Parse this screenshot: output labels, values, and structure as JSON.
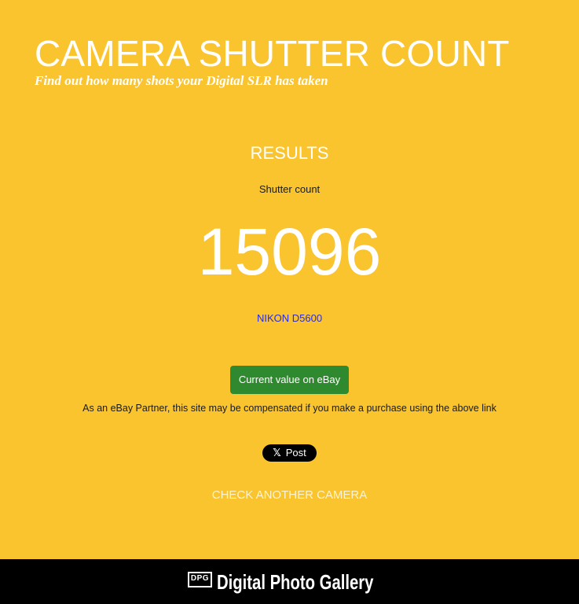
{
  "header": {
    "title": "CAMERA SHUTTER COUNT",
    "tagline": "Find out how many shots your Digital SLR has taken"
  },
  "results": {
    "heading": "RESULTS",
    "count_label": "Shutter count",
    "count_value": "15096",
    "camera_model": "NIKON D5600"
  },
  "ebay": {
    "button_label": "Current value on eBay",
    "disclaimer": "As an eBay Partner, this site may be compensated if you make a purchase using the above link"
  },
  "share": {
    "x_glyph": "𝕏",
    "post_label": "Post"
  },
  "actions": {
    "check_another": "CHECK ANOTHER CAMERA"
  },
  "footer": {
    "logo_text": "DPG",
    "brand_name": "Digital Photo Gallery"
  },
  "colors": {
    "background": "#f9c42d",
    "ebay_button": "#2f8a2f",
    "camera_link": "#2b2bd6",
    "footer_bg": "#000000"
  }
}
